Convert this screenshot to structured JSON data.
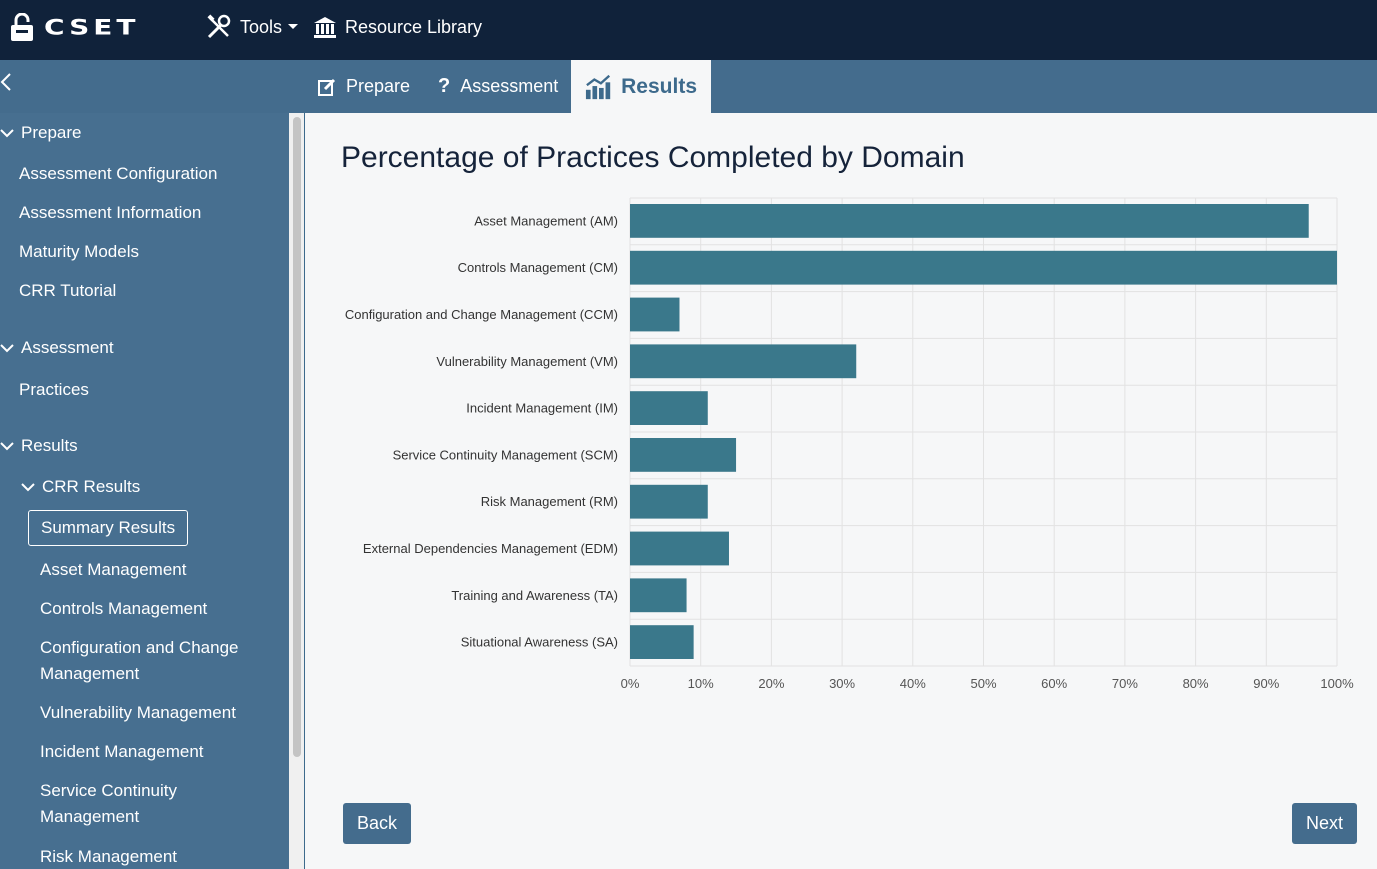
{
  "app": {
    "logo_text": "CSET"
  },
  "topnav": {
    "tools_label": "Tools",
    "resource_label": "Resource Library"
  },
  "tabs": [
    {
      "label": "Prepare"
    },
    {
      "label": "Assessment"
    },
    {
      "label": "Results"
    }
  ],
  "sidebar": {
    "prepare_header": "Prepare",
    "prepare_items": [
      "Assessment Configuration",
      "Assessment Information",
      "Maturity Models",
      "CRR Tutorial"
    ],
    "assessment_header": "Assessment",
    "assessment_items": [
      "Practices"
    ],
    "results_header": "Results",
    "crr_results_header": "CRR Results",
    "crr_items": [
      "Summary Results",
      "Asset Management",
      "Controls Management",
      "Configuration and Change",
      "Management",
      "Vulnerability Management",
      "Incident Management",
      "Service Continuity",
      "Management",
      "Risk Management"
    ]
  },
  "main": {
    "title": "Percentage of Practices Completed by Domain",
    "back_label": "Back",
    "next_label": "Next"
  },
  "colors": {
    "bar": "#3a788b",
    "header": "#10223a",
    "accent": "#446c8d"
  },
  "chart_data": {
    "type": "bar",
    "orientation": "horizontal",
    "title": "Percentage of Practices Completed by Domain",
    "categories": [
      "Asset Management (AM)",
      "Controls Management (CM)",
      "Configuration and Change Management (CCM)",
      "Vulnerability Management (VM)",
      "Incident Management (IM)",
      "Service Continuity Management (SCM)",
      "Risk Management (RM)",
      "External Dependencies Management (EDM)",
      "Training and Awareness (TA)",
      "Situational Awareness (SA)"
    ],
    "values": [
      96,
      100,
      7,
      32,
      11,
      15,
      11,
      14,
      8,
      9
    ],
    "xlim": [
      0,
      100
    ],
    "xticks": [
      "0%",
      "10%",
      "20%",
      "30%",
      "40%",
      "50%",
      "60%",
      "70%",
      "80%",
      "90%",
      "100%"
    ],
    "grid": true,
    "legend": "none"
  }
}
